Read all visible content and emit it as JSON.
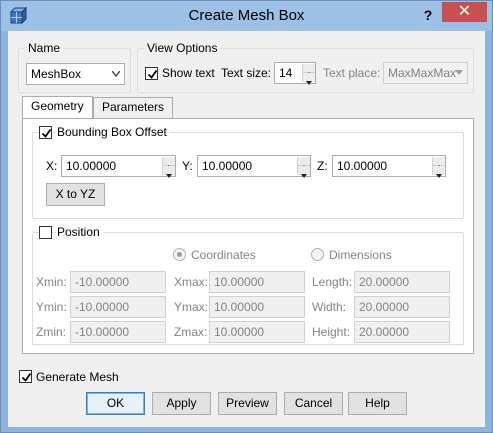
{
  "window": {
    "title": "Create Mesh Box",
    "help_label": "?",
    "close_label": "✕"
  },
  "name_group": {
    "title": "Name",
    "value": "MeshBox"
  },
  "view_options": {
    "title": "View Options",
    "show_text_label": "Show text",
    "show_text_checked": true,
    "text_size_label": "Text size:",
    "text_size_value": "14",
    "text_place_label": "Text place:",
    "text_place_value": "MaxMaxMax"
  },
  "tabs": [
    {
      "label": "Geometry",
      "active": true
    },
    {
      "label": "Parameters",
      "active": false
    }
  ],
  "bounding_box": {
    "title": "Bounding Box Offset",
    "checked": true,
    "x_label": "X:",
    "x_value": "10.00000",
    "y_label": "Y:",
    "y_value": "10.00000",
    "z_label": "Z:",
    "z_value": "10.00000",
    "x_to_yz_label": "X to YZ"
  },
  "position": {
    "title": "Position",
    "checked": false,
    "coordinates_label": "Coordinates",
    "dimensions_label": "Dimensions",
    "rows": [
      {
        "min_label": "Xmin:",
        "min_value": "-10.00000",
        "max_label": "Xmax:",
        "max_value": "10.00000",
        "dim_label": "Length:",
        "dim_value": "20.00000"
      },
      {
        "min_label": "Ymin:",
        "min_value": "-10.00000",
        "max_label": "Ymax:",
        "max_value": "10.00000",
        "dim_label": "Width:",
        "dim_value": "20.00000"
      },
      {
        "min_label": "Zmin:",
        "min_value": "-10.00000",
        "max_label": "Zmax:",
        "max_value": "10.00000",
        "dim_label": "Height:",
        "dim_value": "20.00000"
      }
    ]
  },
  "generate_mesh": {
    "label": "Generate Mesh",
    "checked": true
  },
  "buttons": {
    "ok": "OK",
    "apply": "Apply",
    "preview": "Preview",
    "cancel": "Cancel",
    "help": "Help"
  }
}
